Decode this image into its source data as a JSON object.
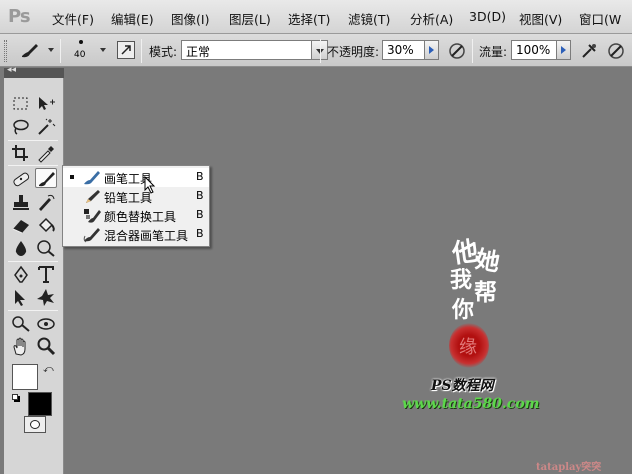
{
  "app": {
    "logo": "Ps"
  },
  "menu": {
    "items": [
      {
        "label": "文件(F)"
      },
      {
        "label": "编辑(E)"
      },
      {
        "label": "图像(I)"
      },
      {
        "label": "图层(L)"
      },
      {
        "label": "选择(T)"
      },
      {
        "label": "滤镜(T)"
      },
      {
        "label": "分析(A)"
      },
      {
        "label": "3D(D)"
      },
      {
        "label": "视图(V)"
      },
      {
        "label": "窗口(W"
      }
    ]
  },
  "options": {
    "brush_size": "40",
    "mode_label": "模式:",
    "mode_value": "正常",
    "opacity_label": "不透明度:",
    "opacity_value": "30%",
    "flow_label": "流量:",
    "flow_value": "100%"
  },
  "flyout": {
    "items": [
      {
        "label": "画笔工具",
        "key": "B",
        "icon": "brush-icon",
        "selected": true
      },
      {
        "label": "铅笔工具",
        "key": "B",
        "icon": "pencil-icon",
        "selected": false
      },
      {
        "label": "颜色替换工具",
        "key": "B",
        "icon": "color-replacement-icon",
        "selected": false
      },
      {
        "label": "混合器画笔工具",
        "key": "B",
        "icon": "mixer-brush-icon",
        "selected": false
      }
    ]
  },
  "colors": {
    "canvas_bg": "#7a7a7a",
    "foreground": "#ffffff",
    "background": "#000000",
    "seal": "#b21010",
    "watermark_green": "#5cd84a"
  },
  "watermark": {
    "calligraphy": [
      "他",
      "她",
      "我",
      "帮",
      "你"
    ],
    "seal_text": "缘",
    "site_name": "PS数程网",
    "site_url": "www.tata580.com",
    "corner": "tataplay突突"
  }
}
